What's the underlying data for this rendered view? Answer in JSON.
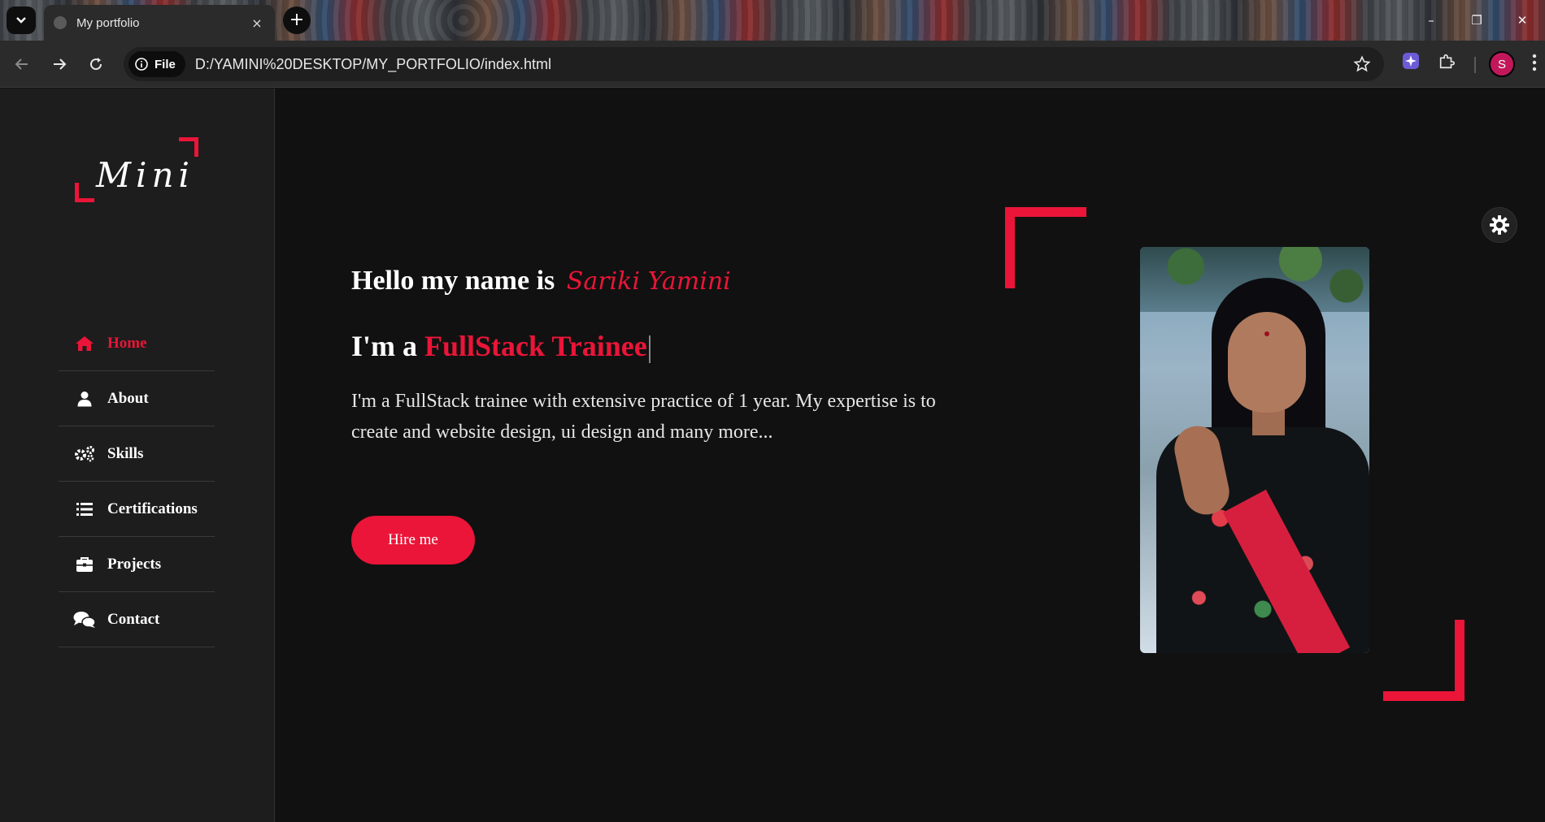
{
  "browser": {
    "tab_title": "My portfolio",
    "tab_close_glyph": "×",
    "new_tab_glyph": "+",
    "window_controls": {
      "minimize": "–",
      "restore": "❐",
      "close": "✕"
    },
    "site_chip_label": "File",
    "url": "D:/YAMINI%20DESKTOP/MY_PORTFOLIO/index.html",
    "profile_initial": "S",
    "icons": [
      "back-icon",
      "forward-icon",
      "reload-icon",
      "info-icon",
      "star-icon",
      "extension-puzzle-icon",
      "kebab-menu-icon"
    ]
  },
  "sidebar": {
    "logo_text": "Mini",
    "nav": [
      {
        "label": "Home",
        "icon": "home-icon",
        "active": true
      },
      {
        "label": "About",
        "icon": "user-icon",
        "active": false
      },
      {
        "label": "Skills",
        "icon": "gears-icon",
        "active": false
      },
      {
        "label": "Certifications",
        "icon": "list-icon",
        "active": false
      },
      {
        "label": "Projects",
        "icon": "briefcase-icon",
        "active": false
      },
      {
        "label": "Contact",
        "icon": "chat-icon",
        "active": false
      }
    ]
  },
  "hero": {
    "greeting": "Hello my name is",
    "name": "Sariki Yamini",
    "role_prefix": "I'm a",
    "role": "FullStack Trainee",
    "description": "I'm a FullStack trainee with extensive practice of 1 year. My expertise is to create and website design, ui design and many more...",
    "cta_label": "Hire me"
  },
  "colors": {
    "accent": "#ea1538",
    "background": "#111111",
    "sidebar": "#1d1d1d"
  }
}
